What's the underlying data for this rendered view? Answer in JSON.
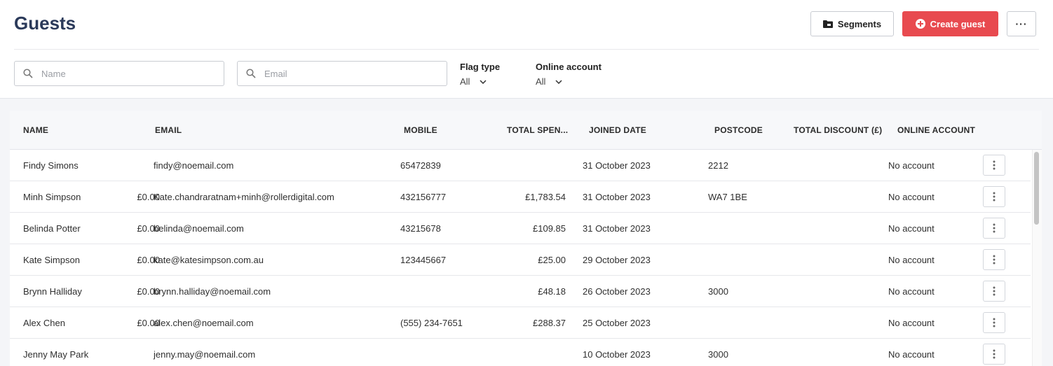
{
  "header": {
    "title": "Guests",
    "segments_label": "Segments",
    "create_label": "Create guest",
    "more_label": "···"
  },
  "filters": {
    "name_placeholder": "Name",
    "email_placeholder": "Email",
    "flag_type": {
      "label": "Flag type",
      "value": "All"
    },
    "online_account": {
      "label": "Online account",
      "value": "All"
    }
  },
  "table": {
    "columns": [
      "NAME",
      "EMAIL",
      "MOBILE",
      "TOTAL SPEN...",
      "JOINED DATE",
      "POSTCODE",
      "TOTAL DISCOUNT (£)",
      "ONLINE ACCOUNT"
    ],
    "rows": [
      {
        "name": "Findy Simons",
        "email": "findy@noemail.com",
        "mobile": "65472839",
        "total_spent": "",
        "joined": "31 October 2023",
        "postcode": "2212",
        "discount": "",
        "online": "No account"
      },
      {
        "name": "Minh Simpson",
        "email": "Kate.chandraratnam+minh@rollerdigital.com",
        "mobile": "432156777",
        "total_spent": "£1,783.54",
        "joined": "31 October 2023",
        "postcode": "WA7 1BE",
        "discount": "£0.00",
        "online": "No account"
      },
      {
        "name": "Belinda Potter",
        "email": "belinda@noemail.com",
        "mobile": "43215678",
        "total_spent": "£109.85",
        "joined": "31 October 2023",
        "postcode": "",
        "discount": "£0.00",
        "online": "No account"
      },
      {
        "name": "Kate Simpson",
        "email": "kate@katesimpson.com.au",
        "mobile": "123445667",
        "total_spent": "£25.00",
        "joined": "29 October 2023",
        "postcode": "",
        "discount": "£0.00",
        "online": "No account"
      },
      {
        "name": "Brynn Halliday",
        "email": "brynn.halliday@noemail.com",
        "mobile": "",
        "total_spent": "£48.18",
        "joined": "26 October 2023",
        "postcode": "3000",
        "discount": "£0.00",
        "online": "No account"
      },
      {
        "name": "Alex Chen",
        "email": "alex.chen@noemail.com",
        "mobile": "(555) 234-7651",
        "total_spent": "£288.37",
        "joined": "25 October 2023",
        "postcode": "",
        "discount": "£0.00",
        "online": "No account"
      },
      {
        "name": "Jenny May Park",
        "email": "jenny.may@noemail.com",
        "mobile": "",
        "total_spent": "",
        "joined": "10 October 2023",
        "postcode": "3000",
        "discount": "",
        "online": "No account"
      }
    ]
  },
  "icons": {
    "segments": "folder-icon",
    "create": "plus-circle-icon",
    "search": "search-icon",
    "dropdown": "chevron-down-icon",
    "row_menu": "kebab-icon"
  },
  "colors": {
    "title": "#2b3a5a",
    "primary": "#e84a4f"
  }
}
